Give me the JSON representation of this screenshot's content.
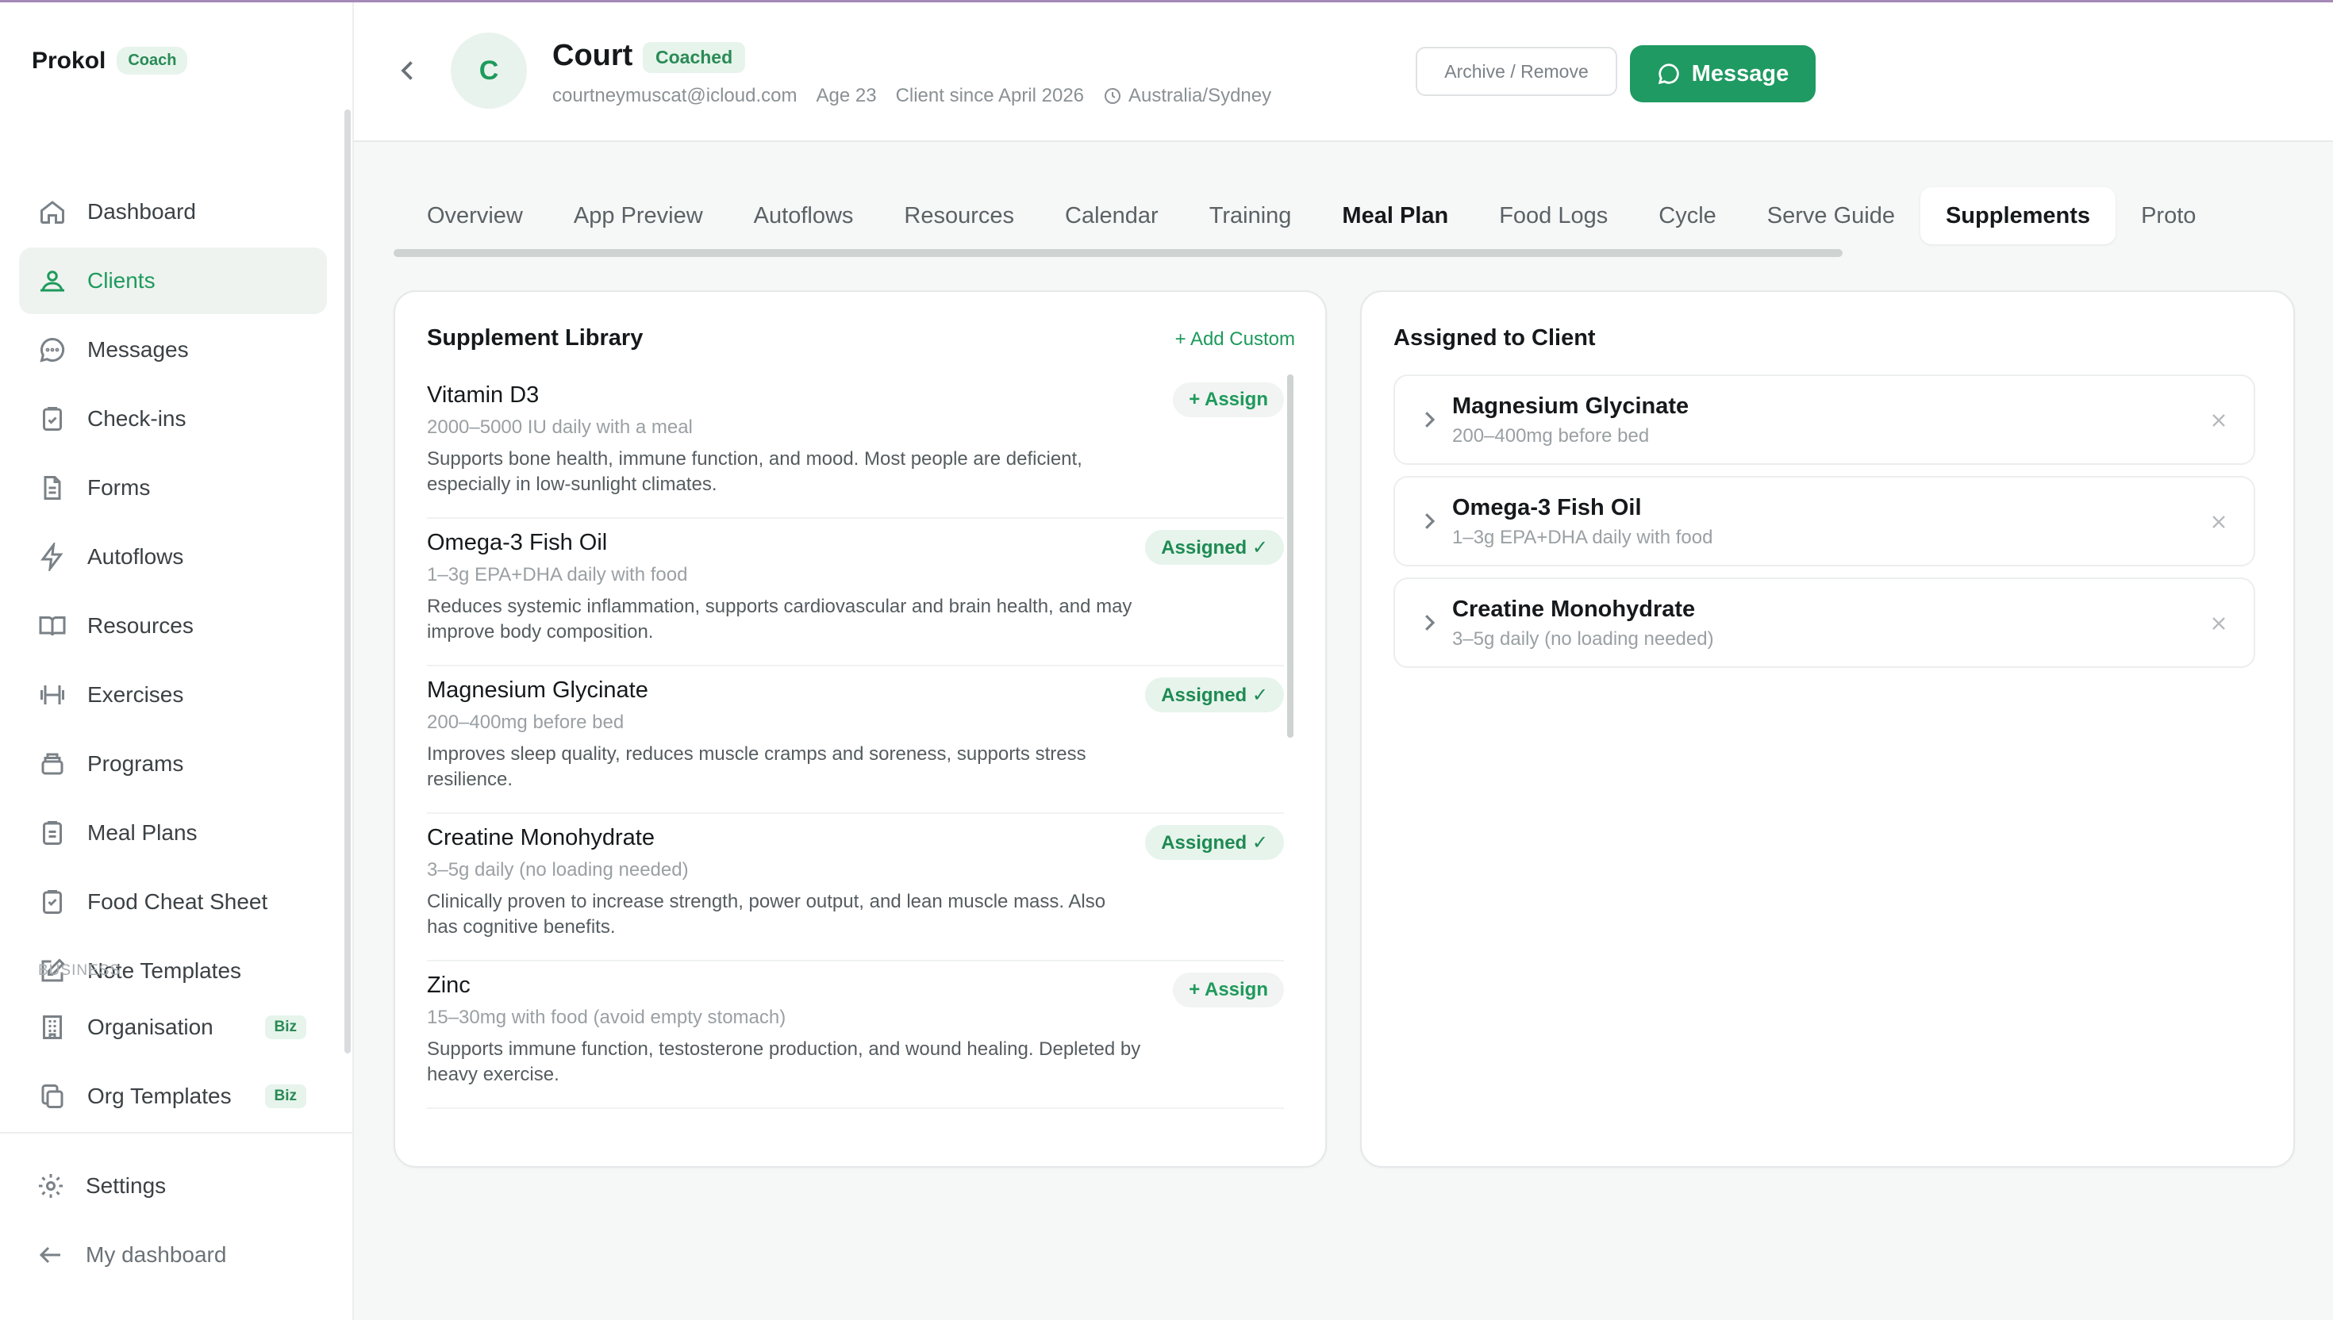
{
  "brand": {
    "name": "Prokol",
    "badge": "Coach"
  },
  "sidebar": {
    "items": [
      {
        "label": "Dashboard",
        "icon": "home-icon"
      },
      {
        "label": "Clients",
        "icon": "users-icon",
        "active": true
      },
      {
        "label": "Messages",
        "icon": "chat-icon"
      },
      {
        "label": "Check-ins",
        "icon": "clipboard-check-icon"
      },
      {
        "label": "Forms",
        "icon": "document-icon"
      },
      {
        "label": "Autoflows",
        "icon": "lightning-icon"
      },
      {
        "label": "Resources",
        "icon": "book-icon"
      },
      {
        "label": "Exercises",
        "icon": "dumbbell-icon"
      },
      {
        "label": "Programs",
        "icon": "stack-icon"
      },
      {
        "label": "Meal Plans",
        "icon": "clipboard-icon"
      },
      {
        "label": "Food Cheat Sheet",
        "icon": "clipboard-list-icon"
      },
      {
        "label": "Note Templates",
        "icon": "edit-icon"
      }
    ],
    "section_business": "BUSINESS",
    "business_items": [
      {
        "label": "Organisation",
        "badge": "Biz",
        "icon": "building-icon"
      },
      {
        "label": "Org Templates",
        "badge": "Biz",
        "icon": "copy-icon"
      }
    ],
    "settings": "Settings",
    "my_dashboard": "My dashboard"
  },
  "client": {
    "initial": "C",
    "name": "Court",
    "badge": "Coached",
    "email": "courtneymuscat@icloud.com",
    "age": "Age 23",
    "since": "Client since April 2026",
    "timezone": "Australia/Sydney"
  },
  "header": {
    "archive_label": "Archive / Remove",
    "message_label": "Message"
  },
  "tabs": [
    "Overview",
    "App Preview",
    "Autoflows",
    "Resources",
    "Calendar",
    "Training",
    "Meal Plan",
    "Food Logs",
    "Cycle",
    "Serve Guide",
    "Supplements",
    "Proto"
  ],
  "library": {
    "title": "Supplement Library",
    "add_custom": "+ Add Custom",
    "items": [
      {
        "name": "Vitamin D3",
        "dose": "2000–5000 IU daily with a meal",
        "desc": "Supports bone health, immune function, and mood. Most people are deficient, especially in low-sunlight climates.",
        "status": "+ Assign"
      },
      {
        "name": "Omega-3 Fish Oil",
        "dose": "1–3g EPA+DHA daily with food",
        "desc": "Reduces systemic inflammation, supports cardiovascular and brain health, and may improve body composition.",
        "status": "Assigned ✓"
      },
      {
        "name": "Magnesium Glycinate",
        "dose": "200–400mg before bed",
        "desc": "Improves sleep quality, reduces muscle cramps and soreness, supports stress resilience.",
        "status": "Assigned ✓"
      },
      {
        "name": "Creatine Monohydrate",
        "dose": "3–5g daily (no loading needed)",
        "desc": "Clinically proven to increase strength, power output, and lean muscle mass. Also has cognitive benefits.",
        "status": "Assigned ✓"
      },
      {
        "name": "Zinc",
        "dose": "15–30mg with food (avoid empty stomach)",
        "desc": "Supports immune function, testosterone production, and wound healing. Depleted by heavy exercise.",
        "status": "+ Assign"
      }
    ]
  },
  "assigned": {
    "title": "Assigned to Client",
    "items": [
      {
        "name": "Magnesium Glycinate",
        "dose": "200–400mg before bed"
      },
      {
        "name": "Omega-3 Fish Oil",
        "dose": "1–3g EPA+DHA daily with food"
      },
      {
        "name": "Creatine Monohydrate",
        "dose": "3–5g daily (no loading needed)"
      }
    ]
  },
  "colors": {
    "accent": "#1f9a62",
    "accent_light": "#e6f4ec"
  }
}
